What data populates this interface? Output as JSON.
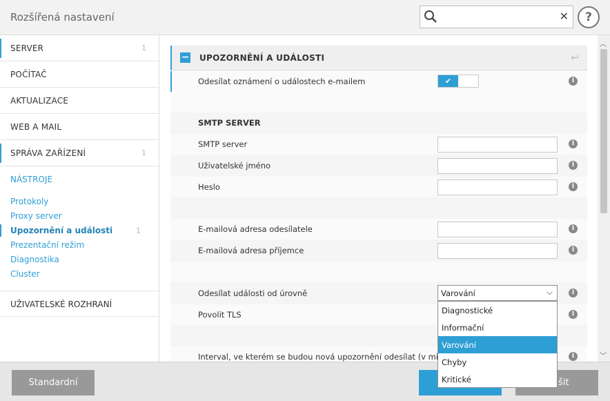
{
  "app": {
    "title": "Rozšířená nastavení"
  },
  "search": {
    "placeholder": "",
    "clear_icon": "close-icon",
    "search_icon": "search-icon"
  },
  "help": {
    "label": "?"
  },
  "sidebar": {
    "items": [
      {
        "label": "SERVER",
        "count": "1"
      },
      {
        "label": "POČÍTAČ",
        "count": ""
      },
      {
        "label": "AKTUALIZACE",
        "count": ""
      },
      {
        "label": "WEB A MAIL",
        "count": ""
      },
      {
        "label": "SPRÁVA ZAŘÍZENÍ",
        "count": "1"
      }
    ],
    "section": "NÁSTROJE",
    "subitems": [
      {
        "label": "Protokoly"
      },
      {
        "label": "Proxy server"
      },
      {
        "label": "Upozornění a události",
        "count": "1",
        "active": true
      },
      {
        "label": "Prezentační režim"
      },
      {
        "label": "Diagnostika"
      },
      {
        "label": "Cluster"
      }
    ],
    "ui_item": "UŽIVATELSKÉ ROZHRANÍ"
  },
  "panel": {
    "title": "UPOZORNĚNÍ A UDÁLOSTI",
    "email_toggle_label": "Odesílat oznámení o událostech e-mailem",
    "email_toggle_on": true,
    "smtp_heading": "SMTP SERVER",
    "fields": {
      "smtp_server": {
        "label": "SMTP server",
        "value": ""
      },
      "username": {
        "label": "Uživatelské jméno",
        "value": ""
      },
      "password": {
        "label": "Heslo",
        "value": ""
      },
      "sender": {
        "label": "E-mailová adresa odesílatele",
        "value": ""
      },
      "recipient": {
        "label": "E-mailová adresa příjemce",
        "value": ""
      }
    },
    "level_label": "Odesílat události od úrovně",
    "level_value": "Varování",
    "tls_label": "Povolit TLS",
    "interval_label": "Interval, ve kterém se budou nová upozornění odesílat (v min.)",
    "info_glyph": "i"
  },
  "dropdown": {
    "options": [
      "Diagnostické",
      "Informační",
      "Varování",
      "Chyby",
      "Kritické"
    ],
    "selected": "Varování"
  },
  "footer": {
    "default_label": "Standardní",
    "ok_label": "",
    "cancel_visible": "šit"
  },
  "colors": {
    "accent": "#2e9fd5",
    "button_gray": "#999999"
  }
}
